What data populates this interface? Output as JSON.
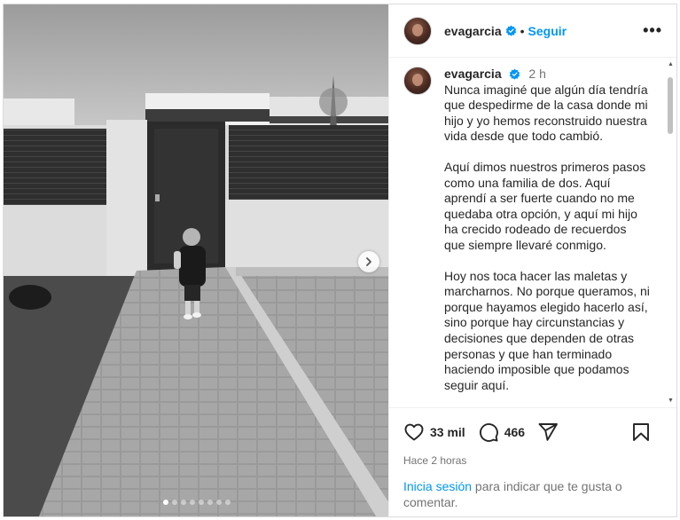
{
  "post": {
    "username": "evagarcia",
    "verified": true,
    "follow_label": "Seguir",
    "more_label": "•••",
    "posted_ago": "2 h",
    "caption_paragraphs": [
      "Nunca imaginé que algún día tendría que despedirme de la casa donde mi hijo y yo hemos reconstruido nuestra vida desde que todo cambió.",
      "Aquí dimos nuestros primeros pasos como una familia de dos. Aquí aprendí a ser fuerte cuando no me quedaba otra opción, y aquí mi hijo ha crecido rodeado de recuerdos que siempre llevaré conmigo.",
      "Hoy nos toca hacer las maletas y marcharnos. No porque queramos, ni porque hayamos elegido hacerlo así, sino porque hay circunstancias y decisiones que dependen de otras personas y que han terminado haciendo imposible que podamos seguir aquí."
    ],
    "likes": "33 mil",
    "comments": "466",
    "time_label": "Hace 2 horas",
    "carousel": {
      "total": 8,
      "active": 1
    }
  },
  "login_prompt": {
    "link_label": "Inicia sesión",
    "text": " para indicar que te gusta o comentar."
  },
  "icons": {
    "verified": "verified-badge-icon",
    "more": "more-options-icon",
    "like": "heart-icon",
    "comment": "comment-bubble-icon",
    "share": "paper-plane-icon",
    "save": "bookmark-icon",
    "next": "chevron-right-icon"
  },
  "colors": {
    "accent": "#0095f6",
    "verified": "#0095f6",
    "muted": "#737373"
  }
}
